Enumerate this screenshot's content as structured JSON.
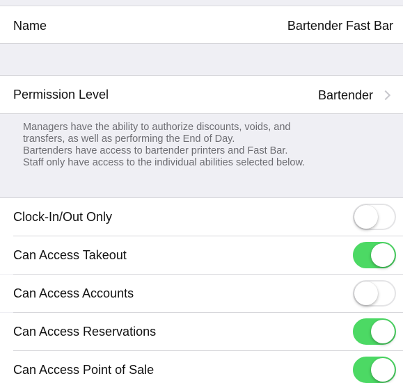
{
  "name_row": {
    "label": "Name",
    "value": "Bartender Fast Bar"
  },
  "permission_row": {
    "label": "Permission Level",
    "value": "Bartender",
    "chevron_icon": "chevron-right-icon"
  },
  "permission_note": {
    "line1": "Managers have the ability to authorize discounts, voids, and",
    "line2": "transfers, as well as performing the End of Day.",
    "line3": "Bartenders have access to bartender printers and Fast Bar.",
    "line4": "Staff only have access to the individual abilities selected below."
  },
  "abilities": [
    {
      "label": "Clock-In/Out Only",
      "enabled": false
    },
    {
      "label": "Can Access Takeout",
      "enabled": true
    },
    {
      "label": "Can Access Accounts",
      "enabled": false
    },
    {
      "label": "Can Access Reservations",
      "enabled": true
    },
    {
      "label": "Can Access Point of Sale",
      "enabled": true
    }
  ],
  "colors": {
    "toggle_on": "#4cd964",
    "toggle_off_border": "#e4e4e6",
    "group_background": "#efeff4",
    "note_text": "#6d6d72"
  }
}
